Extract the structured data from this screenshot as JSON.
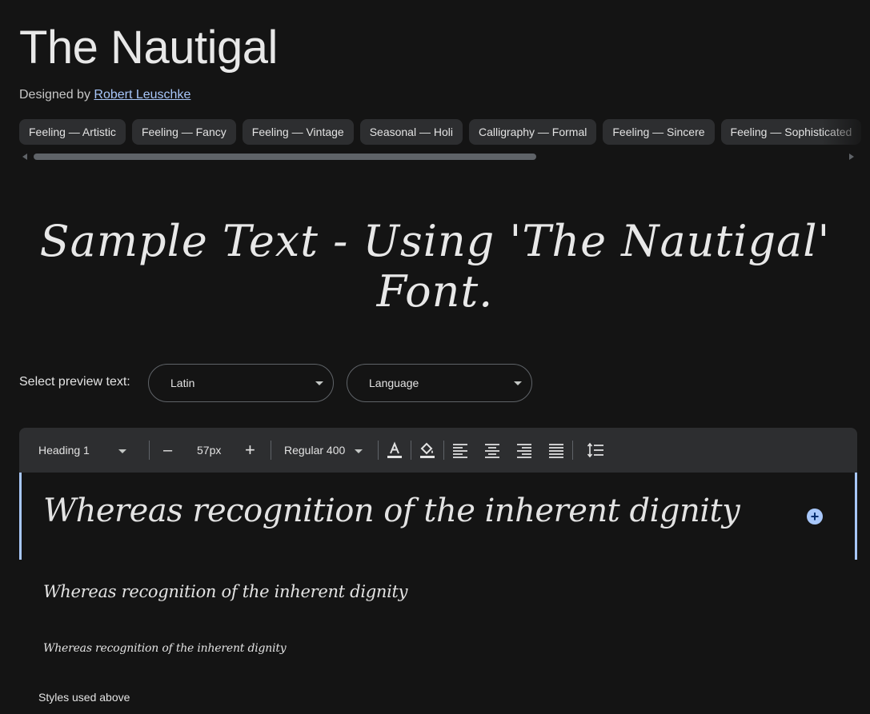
{
  "header": {
    "title": "The Nautigal",
    "designed_by_prefix": "Designed by ",
    "designer_name": "Robert Leuschke"
  },
  "tags": [
    "Feeling — Artistic",
    "Feeling — Fancy",
    "Feeling — Vintage",
    "Seasonal — Holi",
    "Calligraphy — Formal",
    "Feeling — Sincere",
    "Feeling — Sophisticated"
  ],
  "sample": {
    "text": "Sample Text - Using 'The Nautigal' Font."
  },
  "preview_controls": {
    "label": "Select preview text:",
    "script_value": "Latin",
    "language_value": "Language"
  },
  "toolbar": {
    "style_value": "Heading 1",
    "decrease_label": "–",
    "size_value": "57px",
    "increase_label": "+",
    "weight_value": "Regular 400"
  },
  "previews": [
    "Whereas recognition of the inherent dignity",
    "Whereas recognition of the inherent dignity",
    "Whereas recognition of the inherent dignity"
  ],
  "footer": {
    "styles_label": "Styles used above"
  },
  "colors": {
    "background": "#141414",
    "toolbar": "#2d2e30",
    "accent": "#a8c7fa",
    "link": "#a8c7fa"
  },
  "icons": {
    "text_color": "text-color-icon",
    "fill_color": "fill-color-icon",
    "align_left": "align-left-icon",
    "align_center": "align-center-icon",
    "align_right": "align-right-icon",
    "align_justify": "align-justify-icon",
    "line_height": "line-height-icon",
    "add": "add-circle-icon"
  }
}
